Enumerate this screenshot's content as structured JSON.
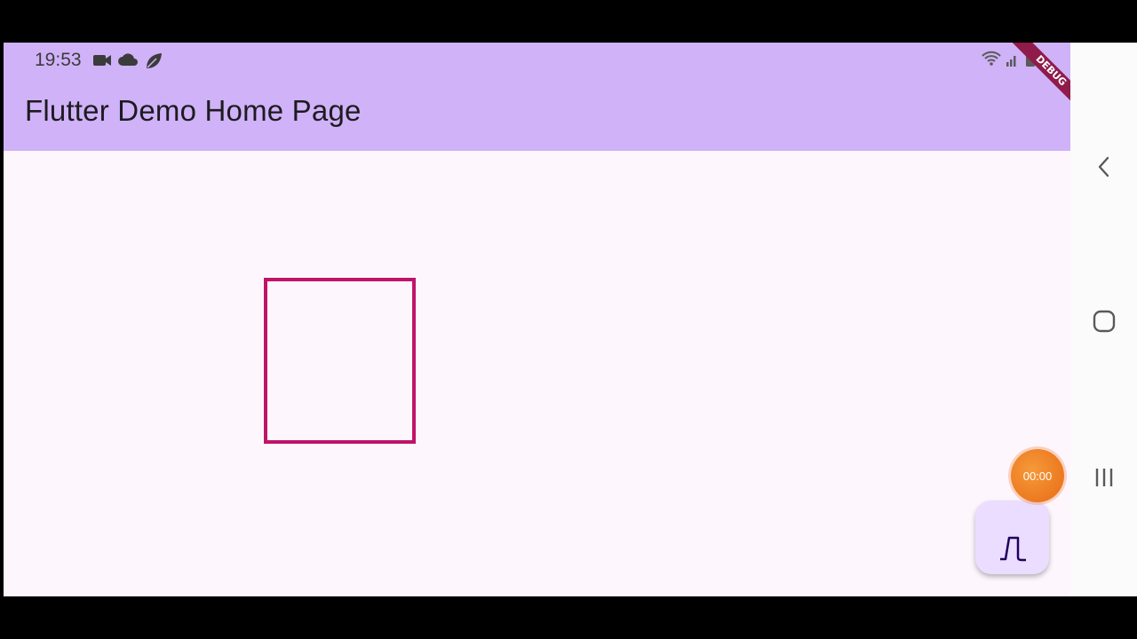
{
  "status_bar": {
    "time": "19:53",
    "left_icons": [
      "video-camera-icon",
      "cloud-icon",
      "leaf-icon"
    ],
    "right_icons": [
      "wifi-icon",
      "signal-icon",
      "battery-icon"
    ]
  },
  "app_bar": {
    "title": "Flutter Demo Home Page",
    "color": "#d0b2f8"
  },
  "debug_banner": {
    "label": "DEBUG",
    "color": "#8f1b4a"
  },
  "canvas": {
    "shape": "square-outline",
    "stroke_color": "#c0136a",
    "background": "#fdf7fd"
  },
  "fab": {
    "icon": "custom-shape-icon",
    "color": "#eaddff"
  },
  "recorder_overlay": {
    "timer": "00:00",
    "color": "#ef7a1f"
  },
  "nav_bar": {
    "buttons": [
      "back-icon",
      "home-icon",
      "recent-apps-icon"
    ]
  }
}
